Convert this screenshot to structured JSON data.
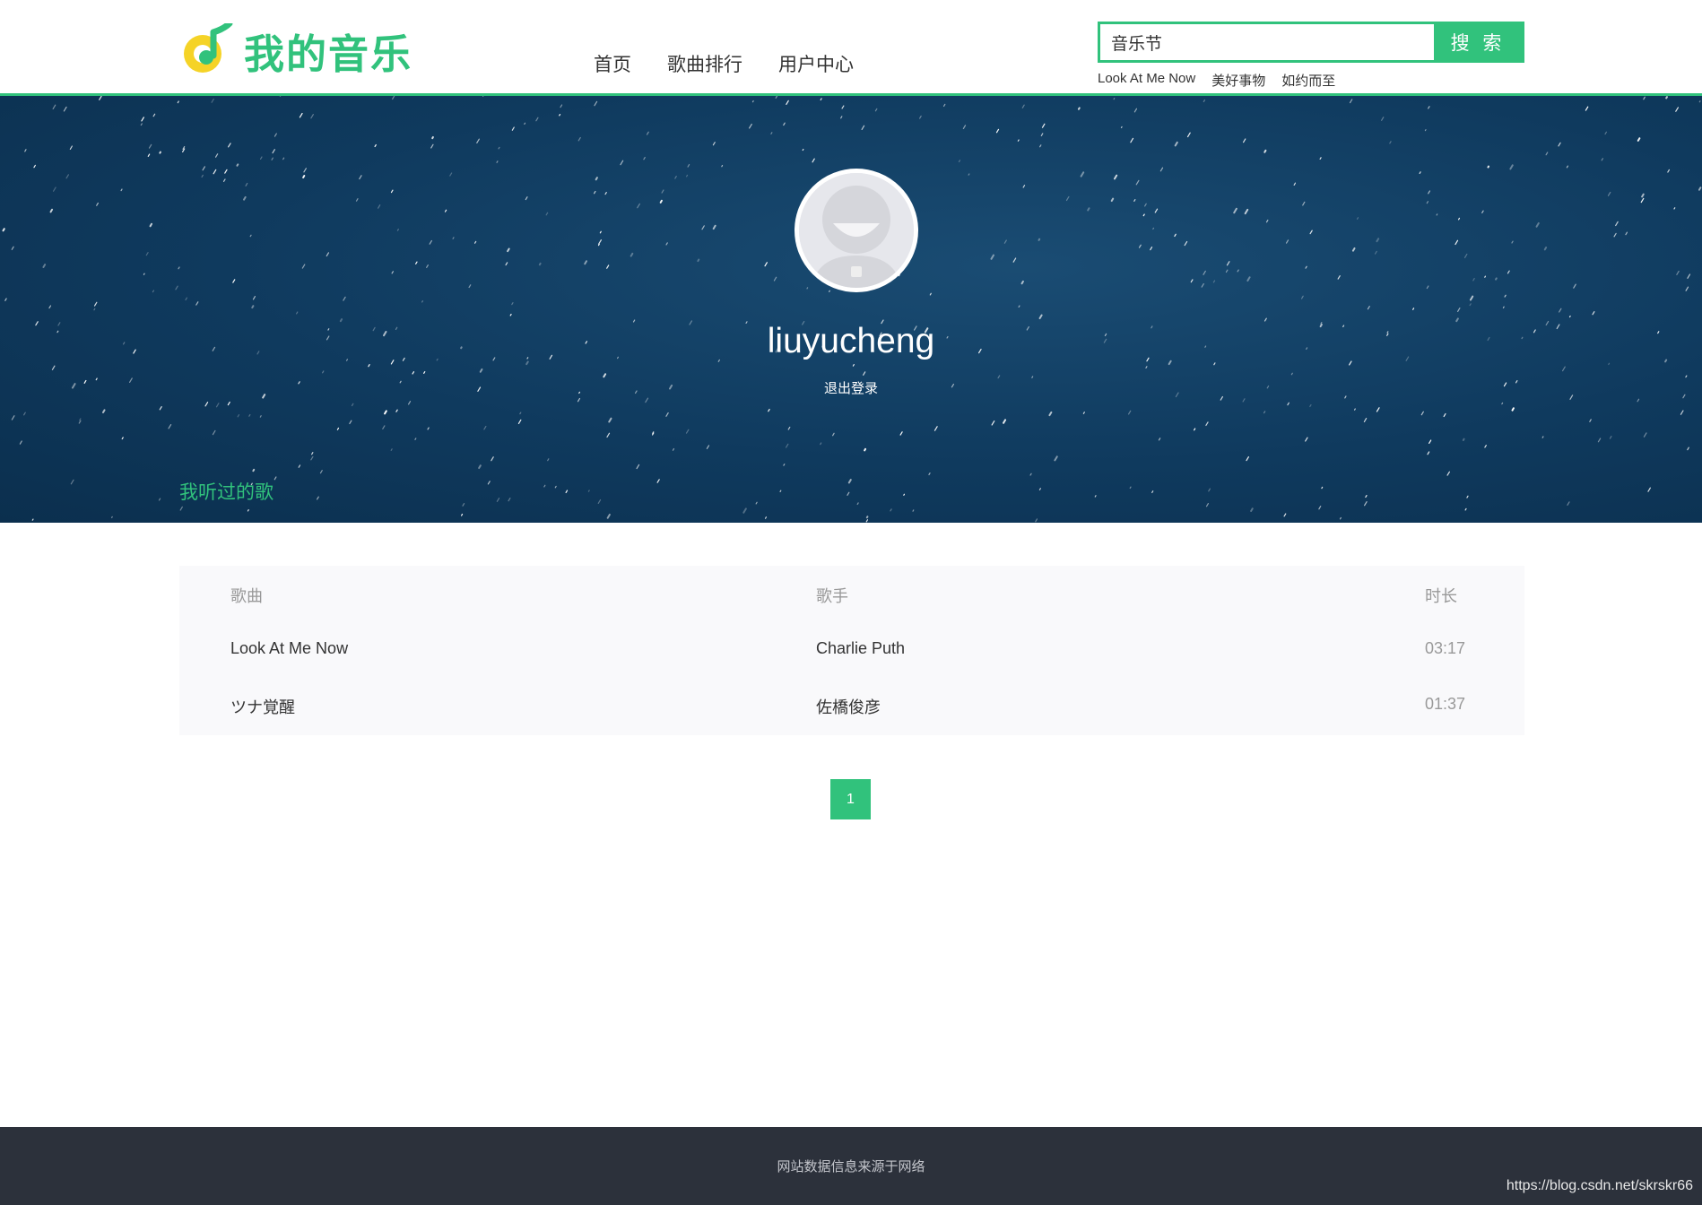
{
  "header": {
    "logo_text": "我的音乐",
    "nav": [
      "首页",
      "歌曲排行",
      "用户中心"
    ],
    "search": {
      "value": "音乐节",
      "button": "搜 索"
    },
    "hot_words": [
      "Look At Me Now",
      "美好事物",
      "如约而至"
    ]
  },
  "profile": {
    "username": "liuyucheng",
    "logout": "退出登录",
    "section_title": "我听过的歌"
  },
  "table": {
    "headers": [
      "歌曲",
      "歌手",
      "时长"
    ],
    "rows": [
      [
        "Look At Me Now",
        "Charlie Puth",
        "03:17"
      ],
      [
        "ツナ覚醒",
        "佐橋俊彦",
        "01:37"
      ]
    ]
  },
  "pagination": {
    "current_page": "1"
  },
  "footer": {
    "text": "网站数据信息来源于网络",
    "watermark": "https://blog.csdn.net/skrskr66"
  },
  "colors": {
    "accent": "#31c27c",
    "footer_bg": "#2c313b",
    "banner_bg": "#0f3a5e"
  }
}
